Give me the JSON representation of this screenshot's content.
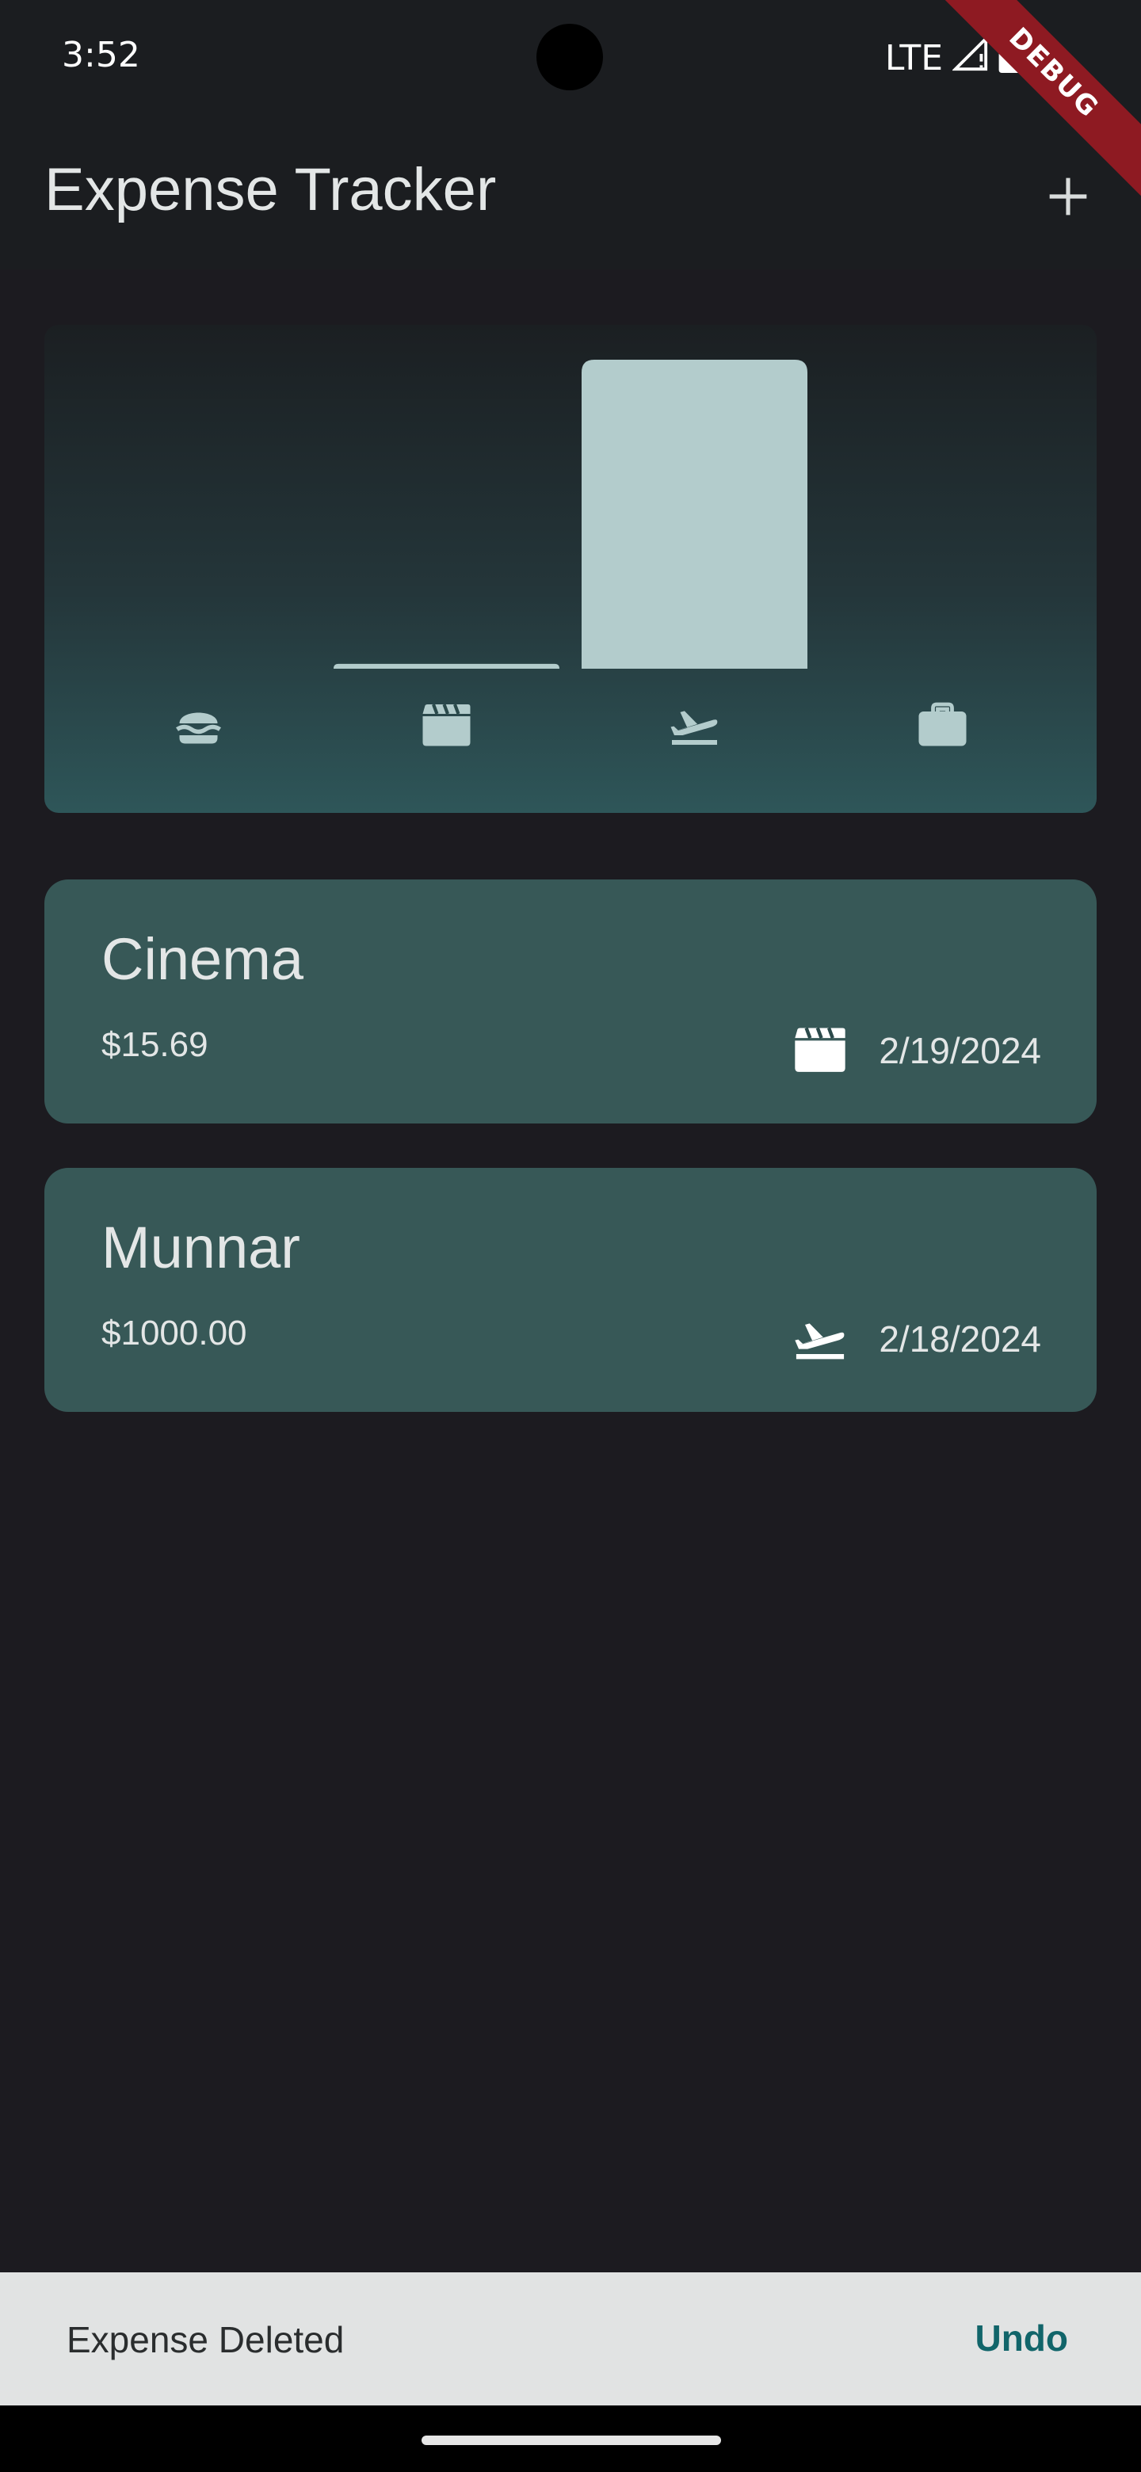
{
  "status_bar": {
    "time": "3:52",
    "network": "LTE"
  },
  "debug_banner": "DEBUG",
  "app_bar": {
    "title": "Expense Tracker",
    "add_icon": "plus-icon"
  },
  "chart_data": {
    "type": "bar",
    "categories": [
      "food",
      "leisure",
      "travel",
      "work"
    ],
    "category_icons": [
      "burger-icon",
      "clapperboard-icon",
      "flight-takeoff-icon",
      "briefcase-icon"
    ],
    "values": [
      0,
      15.69,
      1000.0,
      0
    ],
    "ylim": [
      0,
      1000
    ],
    "bar_color": "#b3cccc",
    "grid": false
  },
  "expenses": [
    {
      "title": "Cinema",
      "amount": "$15.69",
      "date": "2/19/2024",
      "icon": "clapperboard-icon"
    },
    {
      "title": "Munnar",
      "amount": "$1000.00",
      "date": "2/18/2024",
      "icon": "flight-takeoff-icon"
    }
  ],
  "snackbar": {
    "message": "Expense Deleted",
    "action": "Undo"
  },
  "colors": {
    "background": "#1c1b20",
    "card": "#375857",
    "accent": "#11656a",
    "snackbar": "#e1e3e3"
  }
}
